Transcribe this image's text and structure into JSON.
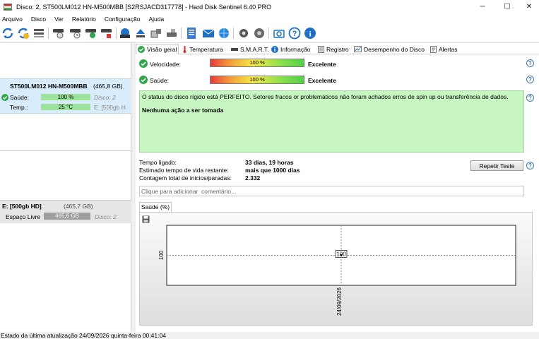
{
  "window": {
    "title": "Disco: 2, ST500LM012 HN-M500MBB [S2RSJACD317778]  -  Hard Disk Sentinel 6.40 PRO",
    "minimize": "─",
    "maximize": "☐",
    "close": "✕"
  },
  "menu": [
    "Arquivo",
    "Disco",
    "Ver",
    "Relatório",
    "Configuração",
    "Ajuda"
  ],
  "disk_card": {
    "name": "ST500LM012 HN-M500MBB",
    "size": "(465,8 GB)",
    "health_label": "Saúde:",
    "health_value": "100 %",
    "health_percent": 100,
    "temp_label": "Temp.:",
    "temp_value": "25 °C",
    "disk_number": "Disco: 2",
    "volume_ref": "E: [500gb H"
  },
  "volume_card": {
    "name": "E: [500gb HD]",
    "size": "(465,7 GB)",
    "free_label": "Espaço Livre",
    "free_value": "465,6 GB",
    "disk_number": "Disco: 2"
  },
  "tabs": [
    "Visão geral",
    "Temperatura",
    "S.M.A.R.T.",
    "Informação",
    "Registro",
    "Desempenho do Disco",
    "Alertas"
  ],
  "overview": {
    "speed_label": "Velocidade:",
    "speed_value": "100 %",
    "speed_percent": 100,
    "speed_result": "Excelente",
    "health_label": "Saúde:",
    "health_value": "100 %",
    "health_percent": 100,
    "health_result": "Excelente",
    "status_message": "O status do disco rígido está PERFEITO. Setores fracos or problemáticos não foram achados erros de spin up ou transferência de dados.",
    "action": "Nenhuma ação a ser tomada",
    "power_on_label": "Tempo ligado:",
    "power_on_value": "33 dias, 19 horas",
    "lifetime_label": "Estimado tempo de vida restante:",
    "lifetime_value": "mais que 1000 dias",
    "starts_label": "Contagem total de inicios/paradas:",
    "starts_value": "2.332",
    "repeat_button": "Repetir Teste",
    "comment_placeholder": "Clique para adicionar  comentário..."
  },
  "chart_tab_label": "Saúde (%)",
  "chart_data": {
    "type": "line",
    "x": [
      "24/09/2026"
    ],
    "values": [
      100
    ],
    "ytick": "100",
    "data_label": "100"
  },
  "statusbar": "Estado da última atualização 24/09/2026 quinta-feira 00:41:04",
  "colors": {
    "ok_green": "#2fa64a",
    "status_box_bg": "#c7f6c2",
    "selected_disk_bg": "#d9ecfb"
  }
}
